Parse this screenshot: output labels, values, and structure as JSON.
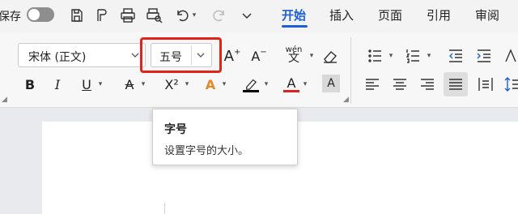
{
  "titlebar": {
    "autosave_label": "保存",
    "tabs": [
      {
        "label": "开始",
        "active": true
      },
      {
        "label": "插入",
        "active": false
      },
      {
        "label": "页面",
        "active": false
      },
      {
        "label": "引用",
        "active": false
      },
      {
        "label": "审阅",
        "active": false
      }
    ],
    "quick_access_icons": [
      "save-icon",
      "format-painter-icon",
      "print-icon",
      "print-preview-icon",
      "undo-icon",
      "redo-icon",
      "more-chevron-icon"
    ]
  },
  "ribbon": {
    "font_name": "宋体 (正文)",
    "font_size": "五号",
    "grow_font_label": "A",
    "shrink_font_label": "A",
    "phonetic_label": "wén",
    "phonetic_char": "文",
    "bold_label": "B",
    "italic_label": "I",
    "underline_label": "U",
    "strike_label": "A",
    "superscript_label": "X²",
    "text_effect_label": "A",
    "highlight_color": "#000000",
    "font_color_label": "A",
    "font_color": "#e02020",
    "char_shading_label": "A"
  },
  "tooltip": {
    "title": "字号",
    "description": "设置字号的大小。"
  },
  "colors": {
    "accent": "#1a5fd8",
    "highlight_border": "#e2221b"
  }
}
